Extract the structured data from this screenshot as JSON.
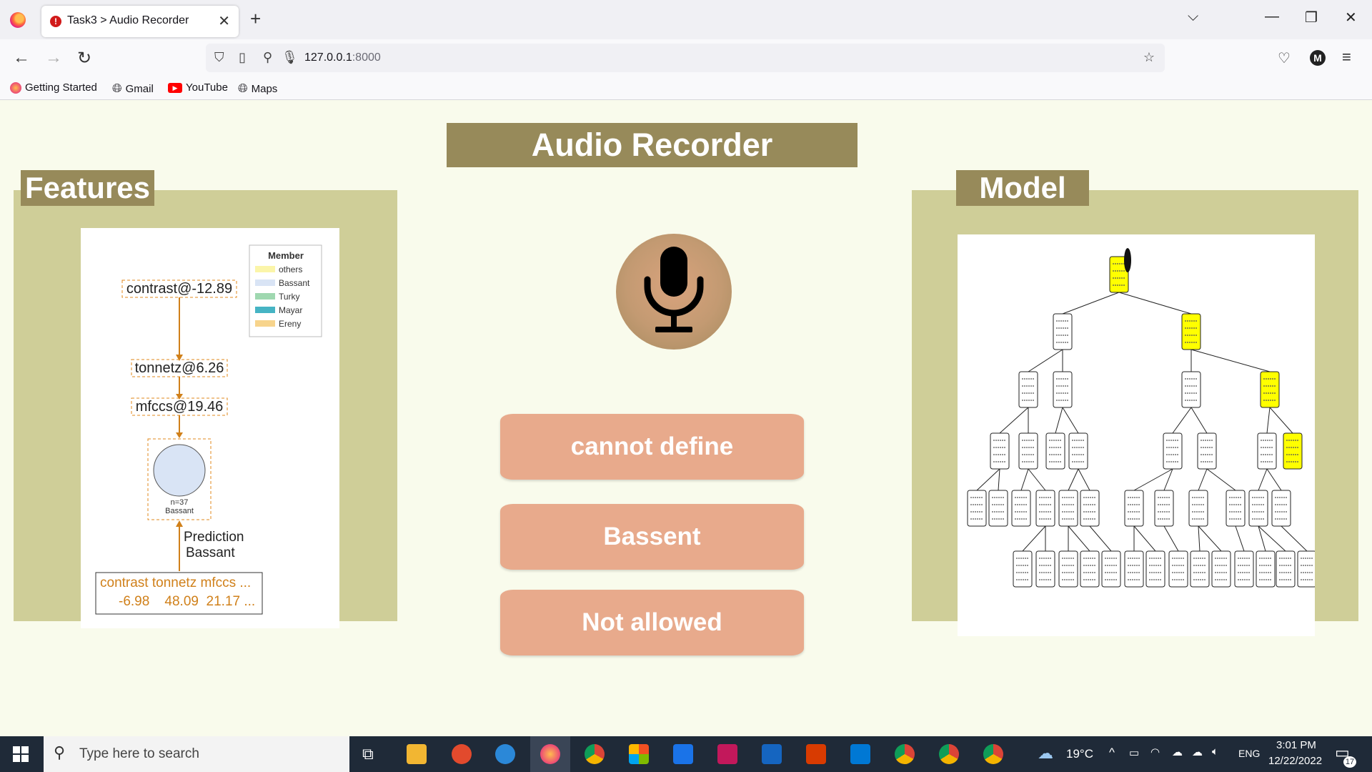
{
  "browser": {
    "tab_title": "Task3 > Audio Recorder",
    "url_host": "127.0.0.1",
    "url_port": ":8000",
    "bookmarks": [
      "Getting Started",
      "Gmail",
      "YouTube",
      "Maps"
    ],
    "profile_initial": "M"
  },
  "page": {
    "title": "Audio Recorder",
    "features_label": "Features",
    "model_label": "Model",
    "results": [
      "cannot define",
      "Bassent",
      "Not allowed"
    ]
  },
  "features_chart": {
    "legend_title": "Member",
    "legend": [
      {
        "name": "others",
        "color": "#fbf5a9"
      },
      {
        "name": "Bassant",
        "color": "#d9e4f5"
      },
      {
        "name": "Turky",
        "color": "#9fd8b0"
      },
      {
        "name": "Mayar",
        "color": "#46b4c4"
      },
      {
        "name": "Ereny",
        "color": "#f7d48c"
      }
    ],
    "nodes": [
      "contrast@-12.89",
      "tonnetz@6.26",
      "mfccs@19.46"
    ],
    "leaf_count": "n=37",
    "leaf_class": "Bassant",
    "prediction_label": "Prediction",
    "prediction_value": "Bassant",
    "feature_headers": "contrast tonnetz mfccs ...",
    "feature_values": "-6.98    48.09  21.17 ..."
  },
  "taskbar": {
    "search_placeholder": "Type here to search",
    "temperature": "19°C",
    "language": "ENG",
    "time": "3:01 PM",
    "date": "12/22/2022",
    "notifications": "17"
  }
}
